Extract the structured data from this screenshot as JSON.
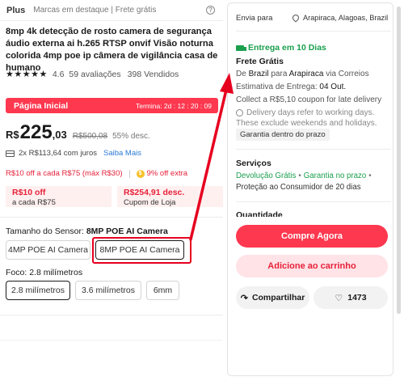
{
  "header": {
    "plus": "Plus",
    "subtitle": "Marcas em destaque | Frete grátis",
    "help": "?"
  },
  "product": {
    "title": "8mp 4k detecção de rosto camera de segurança áudio externa ai h.265 RTSP onvif Visão noturna colorida 4mp poe ip câmera de vigilância casa de humano",
    "stars": "★★★★★",
    "rating": "4.6",
    "reviews": "59 avaliações",
    "sold": "398 Vendidos"
  },
  "promo": {
    "label": "Página Inicial",
    "timer": "Termina: 2d : 12 : 20 : 09"
  },
  "price": {
    "currency": "R$",
    "integer": "225",
    "cents": ",03",
    "old": "R$500,08",
    "discount": "55% desc."
  },
  "installment": {
    "text": "2x R$113,64 com juros",
    "more": "Saiba Mais"
  },
  "offers": {
    "off_text": "R$10 off a cada R$75 (máx R$30)",
    "coin": "$",
    "extra": "9% off extra"
  },
  "coupons": [
    {
      "title": "R$10 off",
      "sub": "a cada R$75"
    },
    {
      "title": "R$254,91 desc.",
      "sub": "Cupom de Loja"
    }
  ],
  "sensor": {
    "label": "Tamanho do Sensor:",
    "value": "8MP POE AI Camera",
    "options": [
      "4MP POE AI Camera",
      "8MP POE AI Camera"
    ],
    "selected": "8MP POE AI Camera"
  },
  "focus": {
    "label": "Foco:",
    "value": "2.8 milímetros",
    "options": [
      "2.8 milímetros",
      "3.6 milímetros",
      "6mm"
    ],
    "selected": "2.8 milímetros"
  },
  "shipping": {
    "ship_to_label": "Envia para",
    "location": "Arapiraca, Alagoas, Brazil",
    "delivery": "Entrega em 10 Dias",
    "free": "Frete Grátis",
    "from_pre": "De",
    "from_country": "Brazil",
    "from_mid": "para",
    "from_city": "Arapiraca",
    "from_post": "via Correios",
    "estimate_label": "Estimativa de Entrega:",
    "estimate_date": "04 Out.",
    "coupon_late": "Collect a R$5,10 coupon for late delivery",
    "note1": "Delivery days refer to working days.",
    "note2": "These exclude weekends and holidays.",
    "guarantee": "Garantia dentro do prazo"
  },
  "services": {
    "title": "Serviços",
    "s1": "Devolução Grátis",
    "dot": "•",
    "s2": "Garantia no prazo",
    "s3": "•",
    "s4": "Proteção ao Consumidor de 20 dias"
  },
  "quantity": {
    "title": "Quantidade"
  },
  "actions": {
    "buy": "Compre Agora",
    "cart": "Adicione ao carrinho",
    "share": "Compartilhar",
    "likes": "1473"
  },
  "colors": {
    "accent": "#fd384f",
    "green": "#1a9f4e",
    "annotation": "#e6001f"
  }
}
